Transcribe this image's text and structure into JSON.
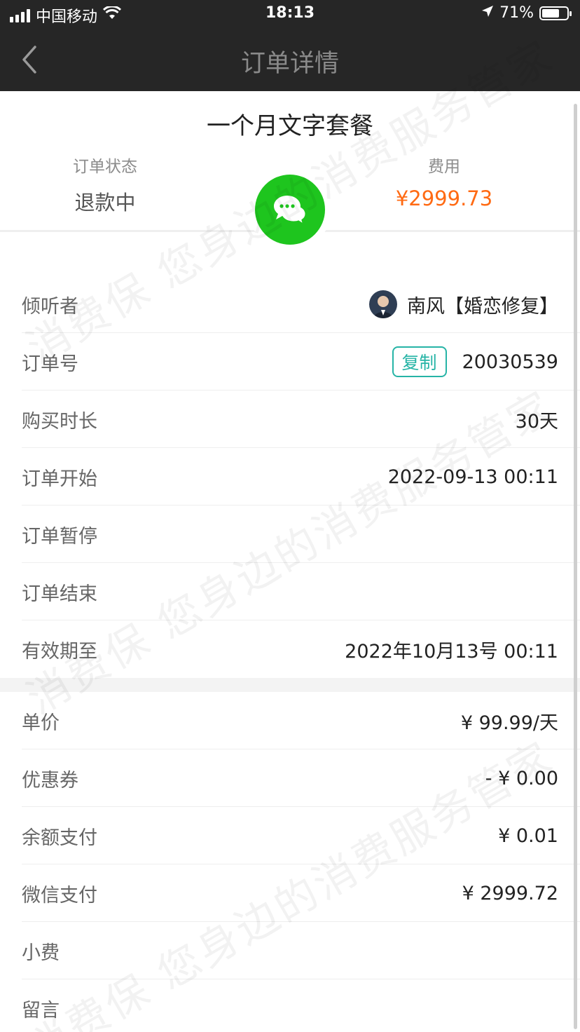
{
  "status_bar": {
    "carrier": "中国移动",
    "time": "18:13",
    "battery": "71%",
    "battery_level": 0.71
  },
  "nav": {
    "title": "订单详情",
    "back_icon": "chevron-left-icon"
  },
  "header": {
    "package_title": "一个月文字套餐",
    "status_label": "订单状态",
    "status_value": "退款中",
    "fee_label": "费用",
    "fee_value": "¥2999.73",
    "chat_icon": "chat-bubble-icon"
  },
  "order": {
    "listener_label": "倾听者",
    "listener_name": "南风【婚恋修复】",
    "order_no_label": "订单号",
    "copy_label": "复制",
    "order_no": "20030539",
    "duration_label": "购买时长",
    "duration": "30天",
    "start_label": "订单开始",
    "start": "2022-09-13 00:11",
    "pause_label": "订单暂停",
    "pause": "",
    "end_label": "订单结束",
    "end": "",
    "valid_label": "有效期至",
    "valid": "2022年10月13号 00:11"
  },
  "payment": {
    "unit_price_label": "单价",
    "unit_price": "¥ 99.99/天",
    "coupon_label": "优惠券",
    "coupon": "- ¥ 0.00",
    "balance_label": "余额支付",
    "balance": "¥ 0.01",
    "wechat_label": "微信支付",
    "wechat": "¥ 2999.72",
    "tip_label": "小费",
    "tip": "",
    "message_label": "留言",
    "message": ""
  },
  "watermark": "消费保 您身边的消费服务管家",
  "colors": {
    "accent_orange": "#ff6a13",
    "chat_green": "#1ec51e",
    "copy_teal": "#26b4a6",
    "nav_bg": "#262626"
  }
}
